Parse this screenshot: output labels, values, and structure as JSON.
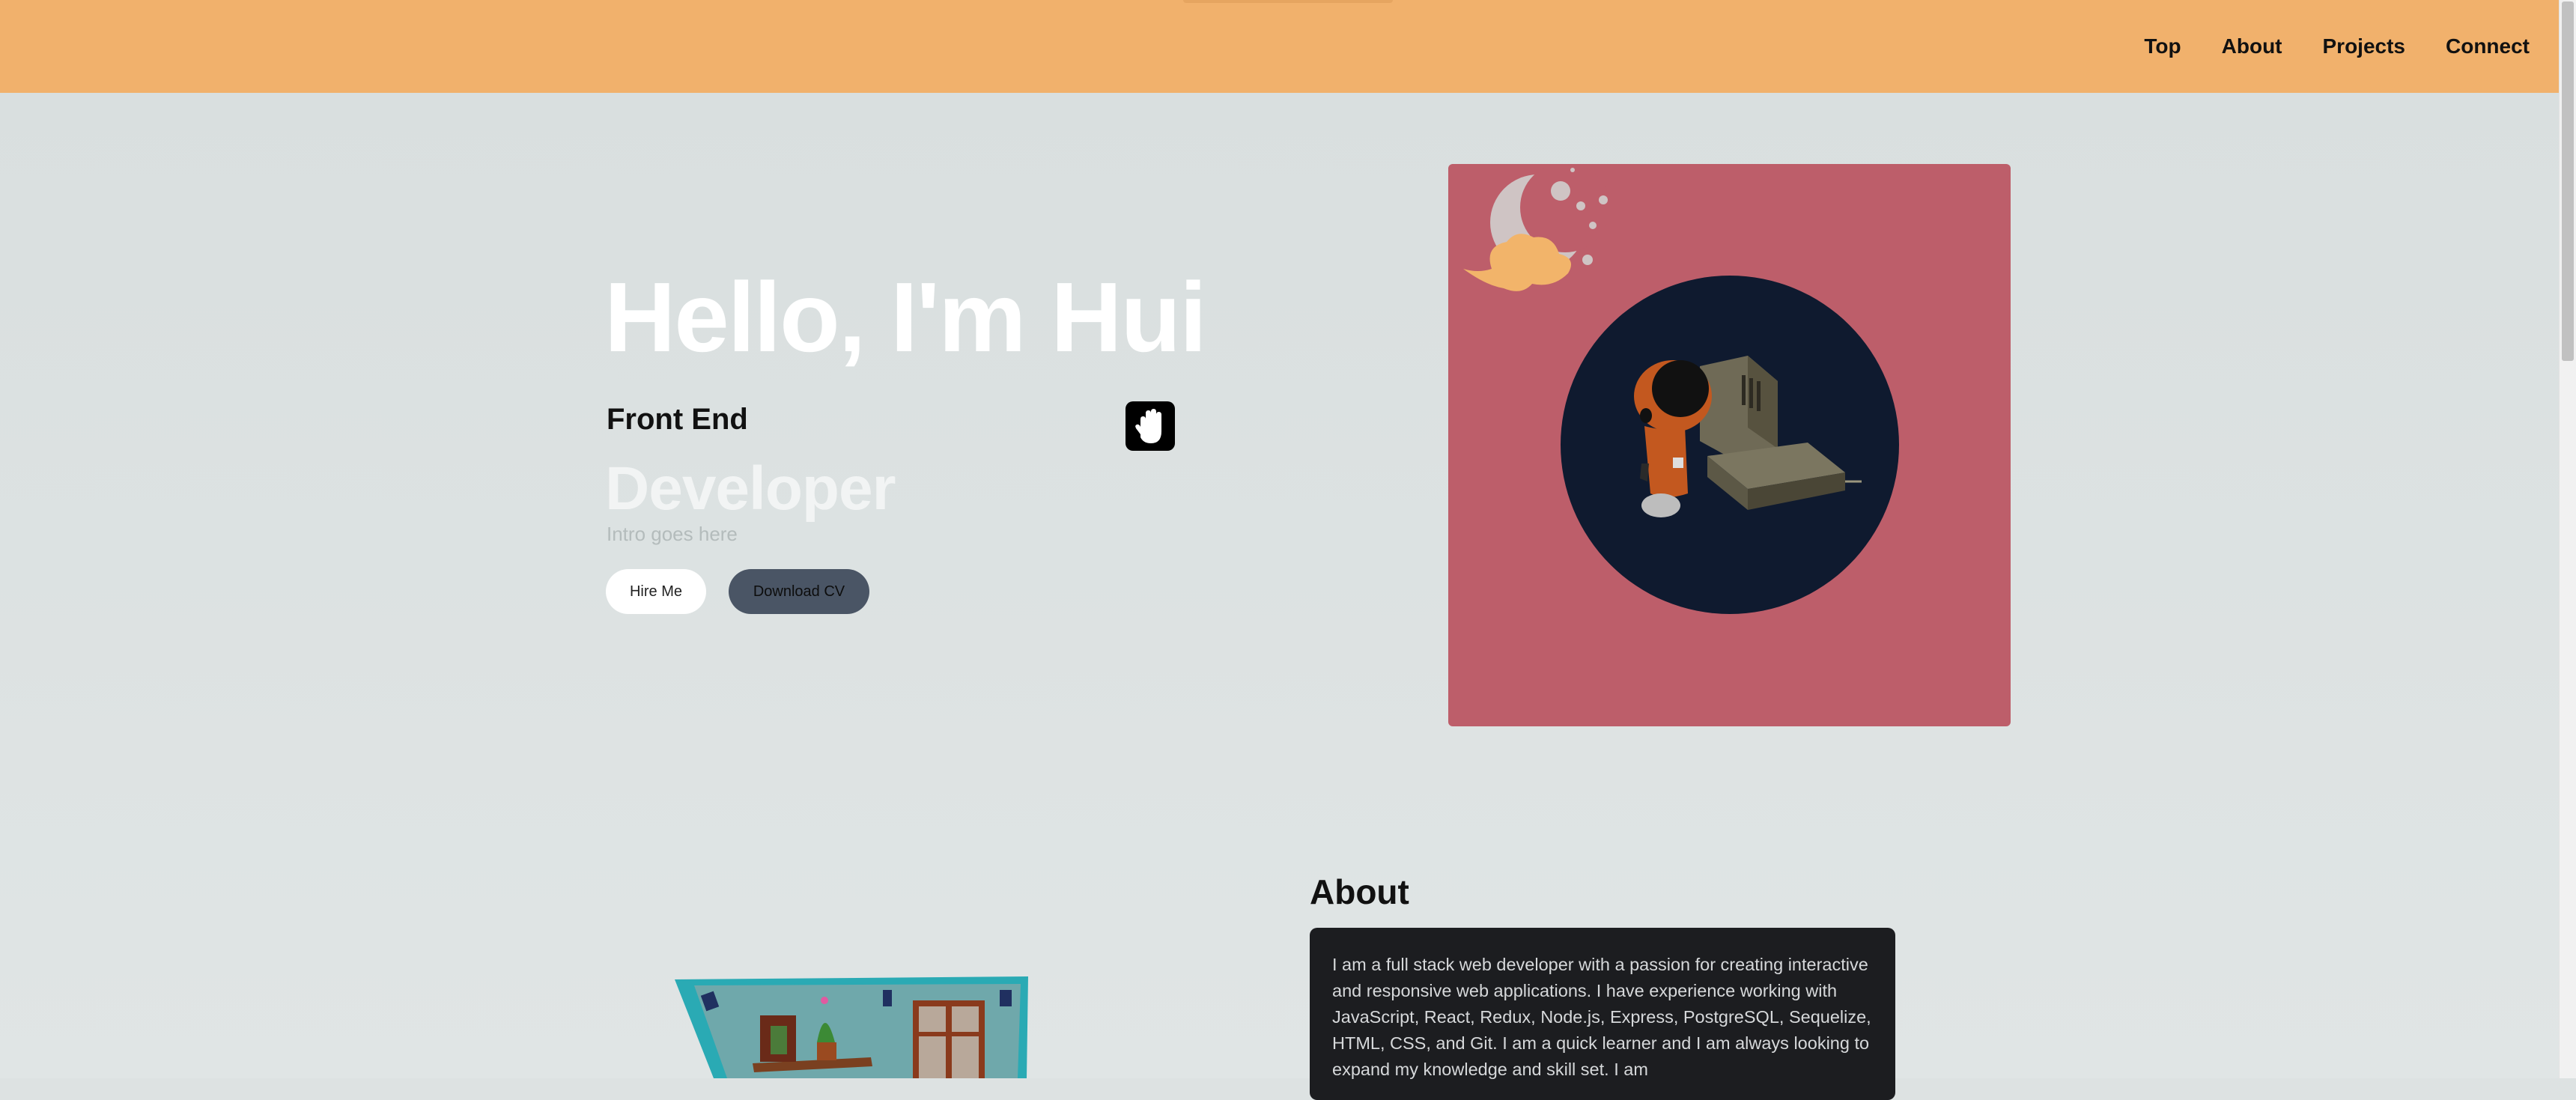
{
  "nav": {
    "links": [
      "Top",
      "About",
      "Projects",
      "Connect"
    ]
  },
  "hero": {
    "title": "Hello, I'm Hui",
    "subtitle": "Front End",
    "role": "Developer",
    "intro": "Intro goes here",
    "hire_label": "Hire Me",
    "cv_label": "Download CV"
  },
  "about": {
    "title": "About",
    "text": "I am a full stack web developer with a passion for creating interactive and responsive web applications. I have experience working with JavaScript, React, Redux, Node.js, Express, PostgreSQL, Sequelize, HTML, CSS, and Git. I am a quick learner and I am always looking to expand my knowledge and skill set. I am"
  },
  "icons": {
    "hand": "raised-hand-icon"
  },
  "colors": {
    "navbar": "#f1b16c",
    "page_background": "#dde2e2",
    "hero_art_background": "#bd5e6a",
    "hero_art_circle": "#0f1a2f",
    "download_cv_button": "#4a5565",
    "hire_button": "#ffffff",
    "about_card": "#1c1d20"
  }
}
